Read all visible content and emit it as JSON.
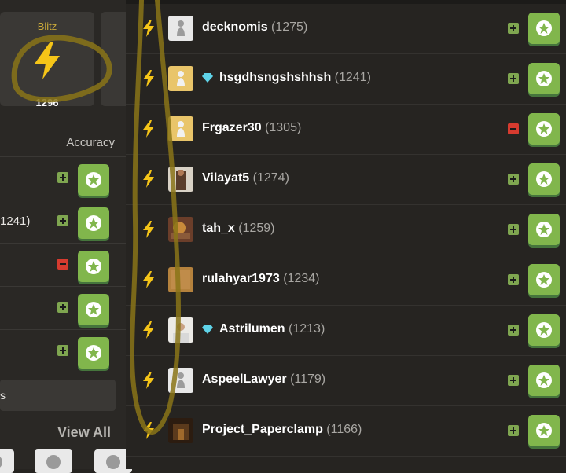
{
  "left_panel": {
    "blitz_label": "Blitz",
    "blitz_rating": "1296",
    "accuracy_label": "Accuracy",
    "rows": [
      {
        "text": "",
        "action": "plus"
      },
      {
        "text": "1241)",
        "action": "plus"
      },
      {
        "text": "",
        "action": "minus"
      },
      {
        "text": "",
        "action": "plus"
      },
      {
        "text": "",
        "action": "plus"
      }
    ],
    "bar_text": "s",
    "view_all": "View All"
  },
  "players": [
    {
      "name": "decknomis",
      "rating": "(1275)",
      "diamond": false,
      "action": "plus",
      "avatar": "pawn-grey"
    },
    {
      "name": "hsgdhsngshshhsh",
      "rating": "(1241)",
      "diamond": true,
      "action": "plus",
      "avatar": "pawn-gold"
    },
    {
      "name": "Frgazer30",
      "rating": "(1305)",
      "diamond": false,
      "action": "minus",
      "avatar": "pawn-gold"
    },
    {
      "name": "Vilayat5",
      "rating": "(1274)",
      "diamond": false,
      "action": "plus",
      "avatar": "photo-person"
    },
    {
      "name": "tah_x",
      "rating": "(1259)",
      "diamond": false,
      "action": "plus",
      "avatar": "photo-art"
    },
    {
      "name": "rulahyar1973",
      "rating": "(1234)",
      "diamond": false,
      "action": "plus",
      "avatar": "photo-texture"
    },
    {
      "name": "Astrilumen",
      "rating": "(1213)",
      "diamond": true,
      "action": "plus",
      "avatar": "photo-person-light"
    },
    {
      "name": "AspeelLawyer",
      "rating": "(1179)",
      "diamond": false,
      "action": "plus",
      "avatar": "pawn-grey"
    },
    {
      "name": "Project_Paperclamp",
      "rating": "(1166)",
      "diamond": false,
      "action": "plus",
      "avatar": "photo-dark"
    }
  ],
  "colors": {
    "accent_green": "#81b64c",
    "bolt_yellow": "#f5c518",
    "minus_red": "#d63b2f",
    "diamond": "#5fd3e8"
  }
}
